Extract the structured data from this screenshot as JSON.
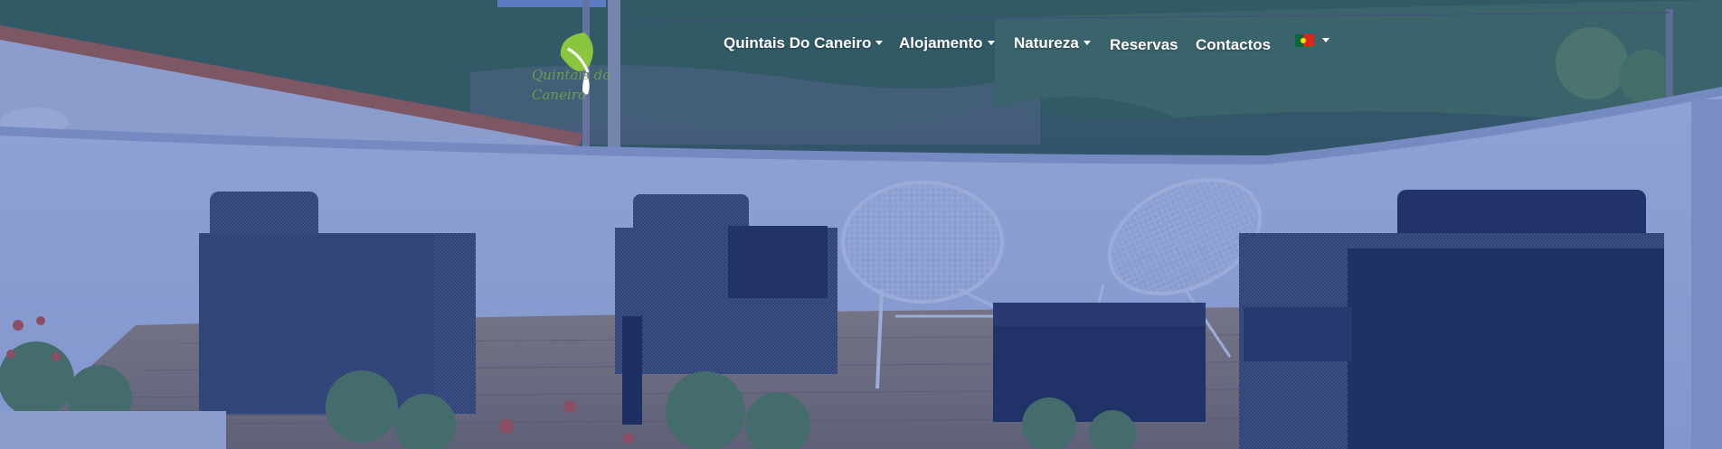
{
  "colors": {
    "overlay": "#2446aa",
    "logo_green": "#79a84a",
    "nav_text": "#ffffff",
    "flag_green": "#046a38",
    "flag_red": "#da291c"
  },
  "logo": {
    "wordmark": "Quintais do Caneiro"
  },
  "nav": {
    "items": [
      {
        "label": "Quintais Do Caneiro",
        "has_dropdown": true
      },
      {
        "label": "Alojamento",
        "has_dropdown": true
      },
      {
        "label": "Natureza",
        "has_dropdown": true
      },
      {
        "label": "Reservas",
        "has_dropdown": false
      },
      {
        "label": "Contactos",
        "has_dropdown": false
      }
    ],
    "language": {
      "flag": "portugal-flag-icon",
      "has_dropdown": true
    }
  },
  "hero": {
    "image": "terrace-with-outdoor-furniture"
  }
}
